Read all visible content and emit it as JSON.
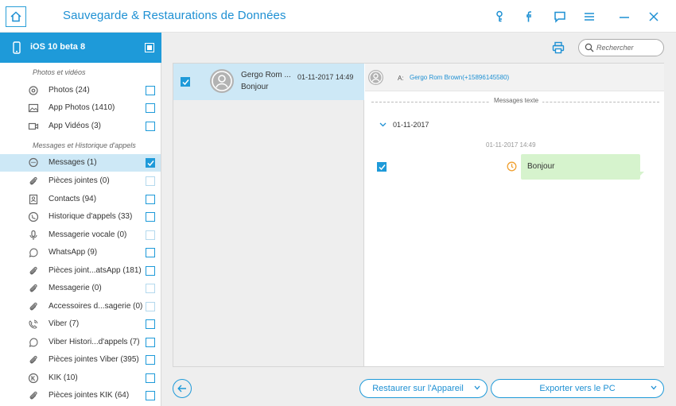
{
  "titlebar": {
    "title": "Sauvegarde & Restaurations de Données",
    "icons": [
      "home-icon",
      "key-icon",
      "facebook-icon",
      "feedback-icon",
      "menu-icon",
      "minimize-icon",
      "close-icon"
    ]
  },
  "device": {
    "name": "iOS 10 beta 8"
  },
  "sidebar": {
    "section_photos": "Photos et vidéos",
    "section_messages": "Messages et Historique d'appels",
    "items": [
      {
        "label": "Photos (24)",
        "icon": "photo-icon",
        "checked": false
      },
      {
        "label": "App Photos (1410)",
        "icon": "image-icon",
        "checked": false
      },
      {
        "label": "App Vidéos (3)",
        "icon": "video-icon",
        "checked": false
      },
      {
        "label": "Messages (1)",
        "icon": "message-icon",
        "checked": true,
        "selected": true
      },
      {
        "label": "Pièces jointes (0)",
        "icon": "attachment-icon",
        "checked": false,
        "dim": true
      },
      {
        "label": "Contacts (94)",
        "icon": "contacts-icon",
        "checked": false
      },
      {
        "label": "Historique d'appels (33)",
        "icon": "call-history-icon",
        "checked": false
      },
      {
        "label": "Messagerie vocale (0)",
        "icon": "microphone-icon",
        "checked": false,
        "dim": true
      },
      {
        "label": "WhatsApp (9)",
        "icon": "whatsapp-icon",
        "checked": false
      },
      {
        "label": "Pièces joint...atsApp (181)",
        "icon": "attachment-icon",
        "checked": false
      },
      {
        "label": "Messagerie (0)",
        "icon": "attachment-icon",
        "checked": false,
        "dim": true
      },
      {
        "label": "Accessoires d...sagerie  (0)",
        "icon": "attachment-icon",
        "checked": false,
        "dim": true
      },
      {
        "label": "Viber (7)",
        "icon": "viber-icon",
        "checked": false
      },
      {
        "label": "Viber Histori...d'appels (7)",
        "icon": "whatsapp-icon",
        "checked": false
      },
      {
        "label": "Pièces jointes Viber (395)",
        "icon": "attachment-icon",
        "checked": false
      },
      {
        "label": "KIK (10)",
        "icon": "kik-icon",
        "checked": false
      },
      {
        "label": "Pièces jointes KIK (64)",
        "icon": "attachment-icon",
        "checked": false
      }
    ]
  },
  "search": {
    "placeholder": "Rechercher"
  },
  "conversation": {
    "name": "Gergo Rom ...",
    "date": "01-11-2017 14:49",
    "preview": "Bonjour"
  },
  "detail": {
    "to_label": "A:",
    "to_value": "Gergo Rom Brown(+15896145580)",
    "divider_label": "Messages texte",
    "date_group": "01-11-2017",
    "message_time": "01-11-2017 14:49",
    "message_text": "Bonjour"
  },
  "footer": {
    "restore_label": "Restaurer sur l'Appareil",
    "export_label": "Exporter vers le PC"
  },
  "colors": {
    "accent": "#1e9ad9",
    "selected_row": "#cde8f6",
    "bubble": "#d6f3cd",
    "clock": "#f0a030"
  }
}
